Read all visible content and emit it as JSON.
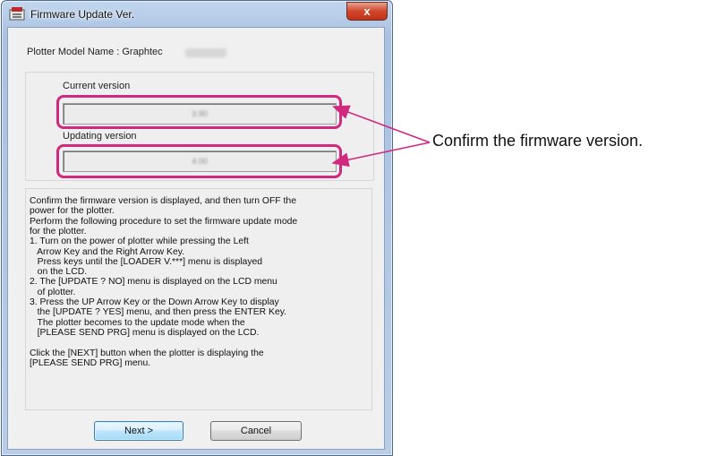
{
  "window": {
    "title": "Firmware Update Ver.",
    "close_label": "x"
  },
  "model": {
    "label": "Plotter Model Name : Graphtec"
  },
  "versions": {
    "current_label": "Current version",
    "current_value": "3.90",
    "updating_label": "Updating version",
    "updating_value": "4.00"
  },
  "instructions": {
    "lines": [
      "Confirm the firmware version is displayed, and then turn OFF the",
      "power for the plotter.",
      "Perform the following procedure to set the firmware update mode",
      "for the plotter.",
      "1. Turn on the power of plotter while pressing the Left",
      "   Arrow Key and the Right Arrow Key.",
      "   Press keys until the [LOADER V.***] menu is displayed",
      "   on the LCD.",
      "2. The [UPDATE ? NO] menu is displayed on the LCD menu",
      "   of plotter.",
      "3. Press the UP Arrow Key or the Down Arrow Key to display",
      "   the [UPDATE ? YES] menu, and then press the ENTER Key.",
      "   The plotter becomes to the update mode when the",
      "   [PLEASE SEND PRG] menu is displayed on the LCD.",
      "",
      "Click the [NEXT] button when the plotter is displaying the",
      "[PLEASE SEND PRG] menu."
    ]
  },
  "buttons": {
    "next_label": "Next >",
    "cancel_label": "Cancel"
  },
  "annotation": {
    "text": "Confirm the firmware version."
  },
  "colors": {
    "highlight": "#d0297f",
    "title_bar": "#a9c2e2",
    "close_button": "#c8412a"
  }
}
